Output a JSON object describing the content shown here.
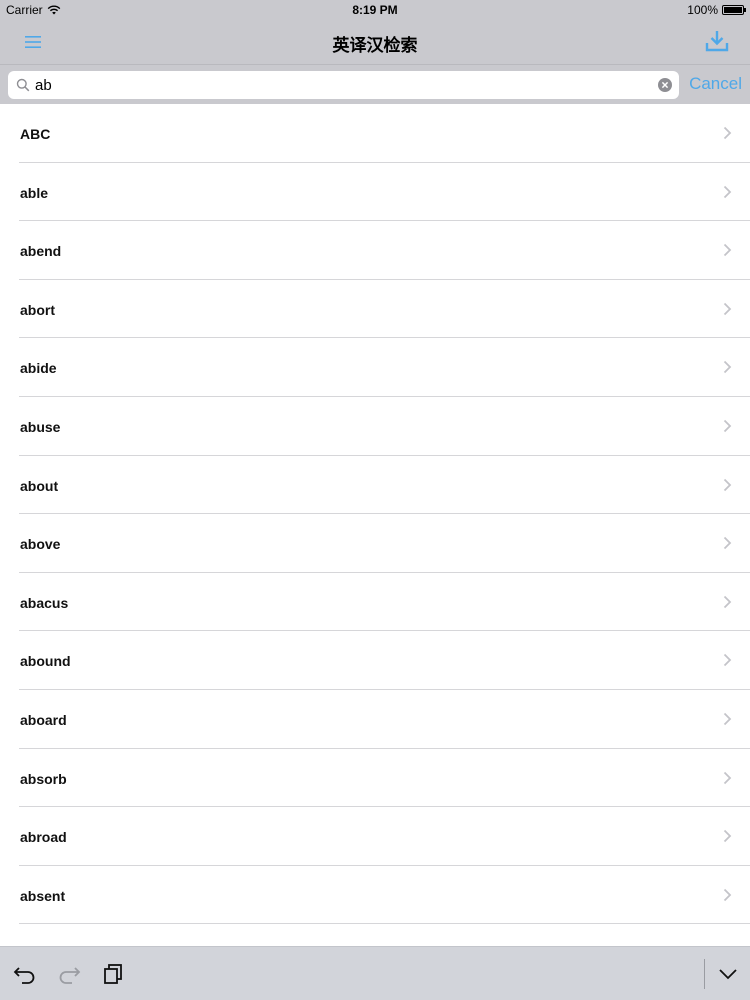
{
  "status_bar": {
    "carrier": "Carrier",
    "time": "8:19 PM",
    "battery_percent": "100%",
    "battery_level": 1.0
  },
  "nav_bar": {
    "title": "英译汉检索",
    "menu_icon": "hamburger-menu-icon",
    "download_icon": "download-icon"
  },
  "search": {
    "value": "ab",
    "placeholder": "",
    "cancel_label": "Cancel"
  },
  "results": [
    {
      "word": "ABC"
    },
    {
      "word": "able"
    },
    {
      "word": "abend"
    },
    {
      "word": "abort"
    },
    {
      "word": "abide"
    },
    {
      "word": "abuse"
    },
    {
      "word": "about"
    },
    {
      "word": "above"
    },
    {
      "word": "abacus"
    },
    {
      "word": "abound"
    },
    {
      "word": "aboard"
    },
    {
      "word": "absorb"
    },
    {
      "word": "abroad"
    },
    {
      "word": "absent"
    }
  ],
  "keyboard_toolbar": {
    "undo_icon": "undo-icon",
    "redo_icon": "redo-icon",
    "paste_icon": "paste-icon",
    "dismiss_icon": "chevron-down-icon"
  },
  "colors": {
    "accent": "#4fa8e8",
    "bar_background": "#c9c9ce",
    "toolbar_background": "#d2d4da"
  }
}
